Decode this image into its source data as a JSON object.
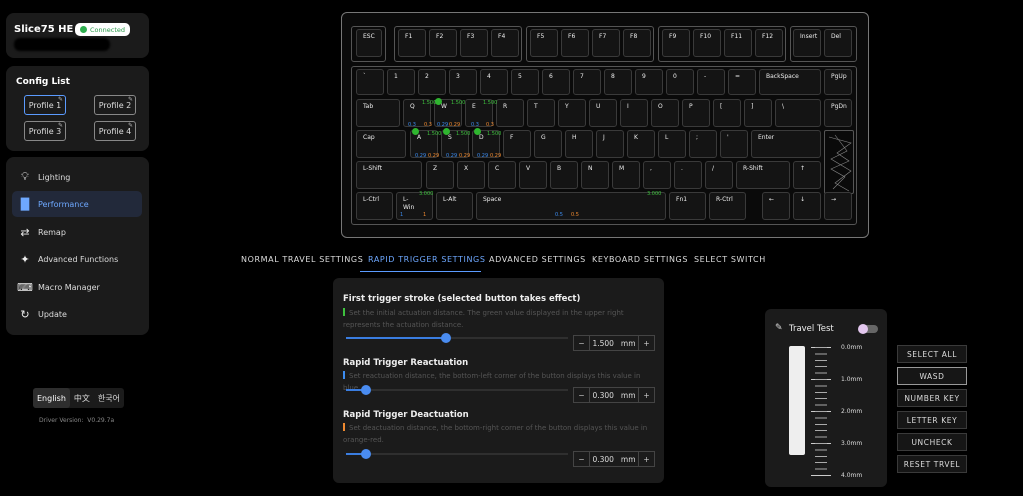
{
  "device": {
    "name": "Slice75 HE",
    "status": "Connected"
  },
  "config": {
    "title": "Config List",
    "profiles": [
      "Profile 1",
      "Profile 2",
      "Profile 3",
      "Profile 4"
    ],
    "active_profile": "Profile 1"
  },
  "sidebar": {
    "items": [
      {
        "label": "Lighting",
        "icon": "bulb-icon"
      },
      {
        "label": "Performance",
        "icon": "bar-chart-icon"
      },
      {
        "label": "Remap",
        "icon": "remap-icon"
      },
      {
        "label": "Advanced Functions",
        "icon": "gamepad-icon"
      },
      {
        "label": "Macro Manager",
        "icon": "macro-icon"
      },
      {
        "label": "Update",
        "icon": "update-icon"
      }
    ],
    "active": "Performance"
  },
  "languages": [
    "English",
    "中文",
    "한국어"
  ],
  "active_language": "English",
  "driver_version": "Driver Version:  V0.29.7a",
  "keys": {
    "esc": "ESC",
    "f1": "F1",
    "f2": "F2",
    "f3": "F3",
    "f4": "F4",
    "f5": "F5",
    "f6": "F6",
    "f7": "F7",
    "f8": "F8",
    "f9": "F9",
    "f10": "F10",
    "f11": "F11",
    "f12": "F12",
    "insert": "Insert",
    "del": "Del",
    "grave": "`",
    "k1": "1",
    "k2": "2",
    "k3": "3",
    "k4": "4",
    "k5": "5",
    "k6": "6",
    "k7": "7",
    "k8": "8",
    "k9": "9",
    "k0": "0",
    "minus": "-",
    "equal": "=",
    "backspace": "BackSpace",
    "pgup": "PgUp",
    "tab": "Tab",
    "q": "Q",
    "w": "W",
    "e": "E",
    "r": "R",
    "t": "T",
    "y": "Y",
    "u": "U",
    "i": "I",
    "o": "O",
    "p": "P",
    "lbracket": "[",
    "rbracket": "]",
    "backslash": "\\",
    "pgdn": "PgDn",
    "caps": "Cap",
    "a": "A",
    "s": "S",
    "d": "D",
    "f": "F",
    "g": "G",
    "h": "H",
    "j": "J",
    "k": "K",
    "l": "L",
    "semicolon": ";",
    "quote": "'",
    "enter": "Enter",
    "lshift": "L-Shift",
    "z": "Z",
    "x": "X",
    "c": "C",
    "v": "V",
    "b": "B",
    "n": "N",
    "m": "M",
    "comma": ",",
    "period": ".",
    "slash": "/",
    "rshift": "R-Shift",
    "up": "↑",
    "lctrl": "L-Ctrl",
    "lwin": "L-\nWin",
    "lalt": "L-Alt",
    "space": "Space",
    "fn1": "Fn1",
    "rctrl": "R-Ctrl",
    "left": "←",
    "down": "↓",
    "right": "→"
  },
  "key_values": {
    "green": "1.500",
    "blue": "0.3",
    "orange": "0.3",
    "blue_alt": "0.29",
    "orange_alt": "0.29",
    "green_lshift": "3.000",
    "green_fn1": "3.000",
    "blue_lctrl": "1",
    "orange_lctrl": "1",
    "blue_space": "0.5",
    "orange_space": "0.5"
  },
  "tabs": [
    "NORMAL TRAVEL SETTINGS",
    "RAPID TRIGGER SETTINGS",
    "ADVANCED SETTINGS",
    "KEYBOARD SETTINGS",
    "SELECT SWITCH"
  ],
  "active_tab": "RAPID TRIGGER SETTINGS",
  "settings": {
    "first_trigger": {
      "title": "First trigger stroke (selected button takes effect)",
      "desc": "Set the initial actuation distance. The green value displayed in the upper right represents the actuation distance.",
      "value": "1.500",
      "unit": "mm",
      "slider_fraction": 0.45,
      "color": "#3ec13e"
    },
    "reactuation": {
      "title": "Rapid Trigger Reactuation",
      "desc": "Set reactuation distance, the bottom-left corner of the button displays this value in blue.",
      "value": "0.300",
      "unit": "mm",
      "slider_fraction": 0.09,
      "color": "#3c8cf0"
    },
    "deactuation": {
      "title": "Rapid Trigger Deactuation",
      "desc": "Set deactuation distance, the bottom-right corner of the button displays this value in orange-red.",
      "value": "0.300",
      "unit": "mm",
      "slider_fraction": 0.09,
      "color": "#f08a30"
    }
  },
  "travel_test": {
    "title": "Travel Test",
    "toggle_on": false,
    "scale": [
      "0.0mm",
      "1.0mm",
      "2.0mm",
      "3.0mm",
      "4.0mm"
    ]
  },
  "select_buttons": [
    "SELECT ALL",
    "WASD",
    "NUMBER KEY",
    "LETTER KEY",
    "UNCHECK",
    "RESET TRVEL"
  ],
  "active_select": "WASD"
}
